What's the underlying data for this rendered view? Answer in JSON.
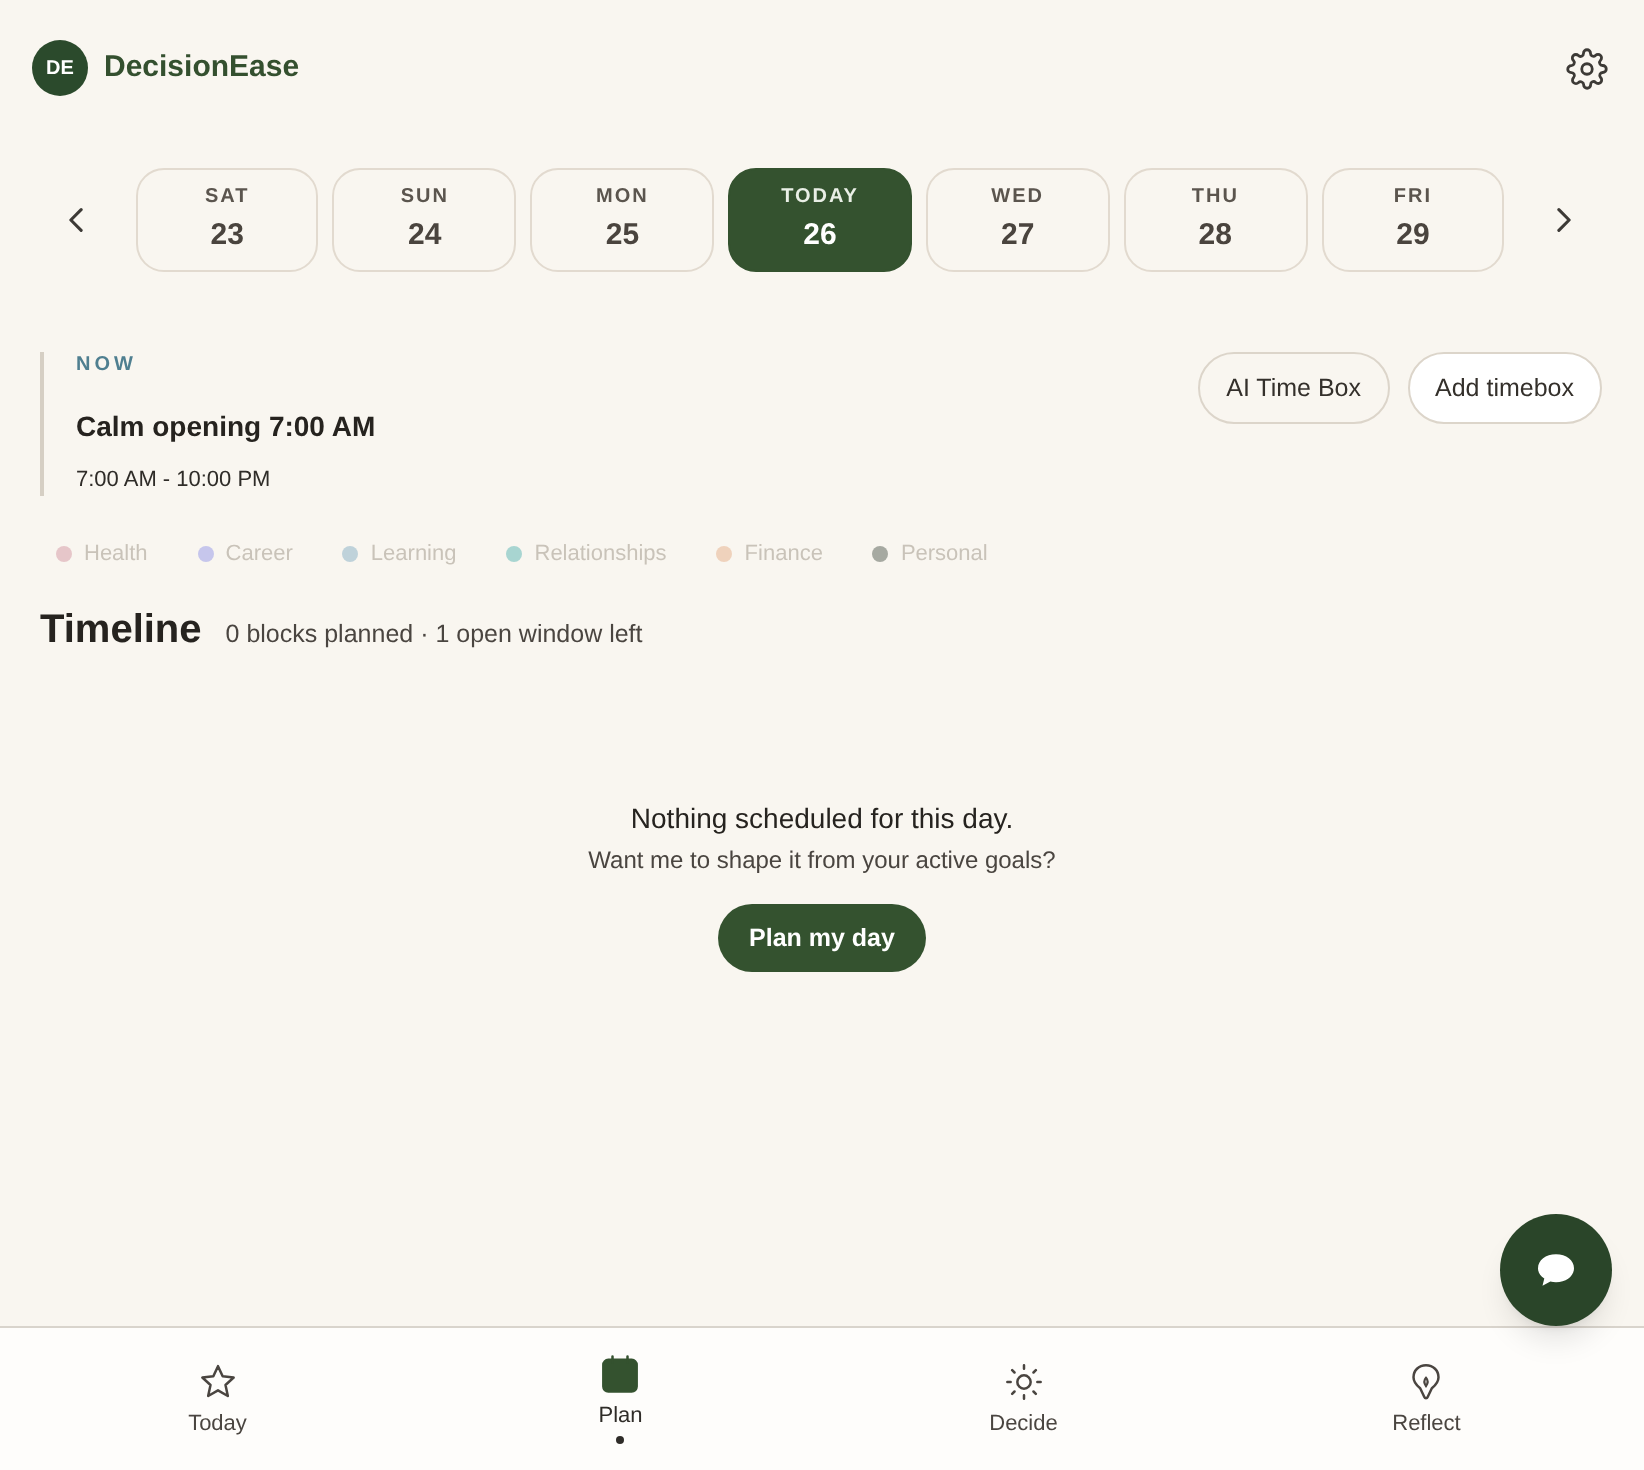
{
  "app": {
    "logo_initials": "DE",
    "name": "DecisionEase"
  },
  "days": [
    {
      "weekday": "SAT",
      "date": "23",
      "selected": false
    },
    {
      "weekday": "SUN",
      "date": "24",
      "selected": false
    },
    {
      "weekday": "MON",
      "date": "25",
      "selected": false
    },
    {
      "weekday": "TODAY",
      "date": "26",
      "selected": true
    },
    {
      "weekday": "WED",
      "date": "27",
      "selected": false
    },
    {
      "weekday": "THU",
      "date": "28",
      "selected": false
    },
    {
      "weekday": "FRI",
      "date": "29",
      "selected": false
    }
  ],
  "now": {
    "label": "NOW",
    "title": "Calm opening 7:00 AM",
    "time_range": "7:00 AM - 10:00 PM"
  },
  "actions": [
    {
      "label": "AI Time Box",
      "kind": "outline"
    },
    {
      "label": "Add timebox",
      "kind": "filled"
    }
  ],
  "categories": [
    {
      "label": "Health",
      "color": "#e6c6c9"
    },
    {
      "label": "Career",
      "color": "#c6c6ec"
    },
    {
      "label": "Learning",
      "color": "#bfd2da"
    },
    {
      "label": "Relationships",
      "color": "#a8d5d1"
    },
    {
      "label": "Finance",
      "color": "#efd2bc"
    },
    {
      "label": "Personal",
      "color": "#a6a9a1"
    }
  ],
  "timeline": {
    "title": "Timeline",
    "summary": "0 blocks planned · 1 open window left"
  },
  "empty_state": {
    "title": "Nothing scheduled for this day.",
    "message": "Want me to shape it from your active goals?",
    "button": "Plan my day"
  },
  "nav": [
    {
      "label": "Today",
      "selected": false
    },
    {
      "label": "Plan",
      "selected": true
    },
    {
      "label": "Decide",
      "selected": false
    },
    {
      "label": "Reflect",
      "selected": false
    }
  ]
}
